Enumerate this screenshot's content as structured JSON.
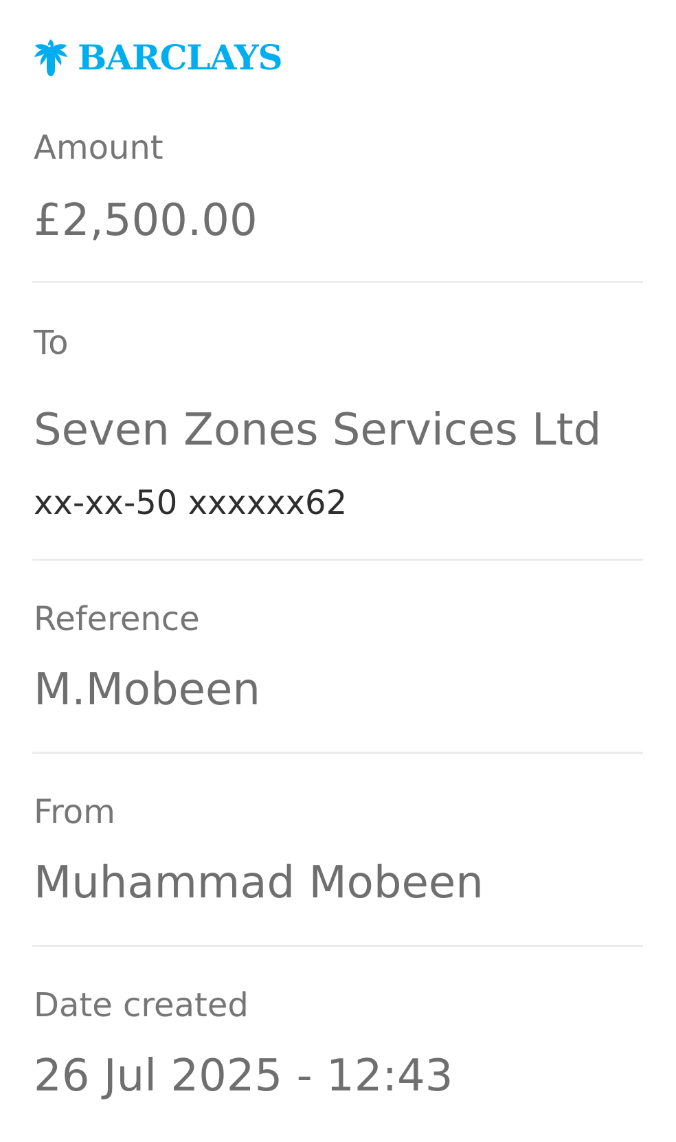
{
  "colors": {
    "brand": "#00aeef",
    "label": "#767676",
    "value": "#6f6f6f",
    "account": "#2e2e2e",
    "divider": "#ececec"
  },
  "brand": {
    "logo_icon": "eagle-icon",
    "name": "BARCLAYS"
  },
  "amount": {
    "label": "Amount",
    "value": "£2,500.00"
  },
  "to": {
    "label": "To",
    "name": "Seven Zones Services Ltd",
    "account": "xx-xx-50 xxxxxx62"
  },
  "reference": {
    "label": "Reference",
    "value": "M.Mobeen"
  },
  "from": {
    "label": "From",
    "value": "Muhammad Mobeen"
  },
  "date_created": {
    "label": "Date created",
    "value": "26 Jul 2025 - 12:43"
  }
}
